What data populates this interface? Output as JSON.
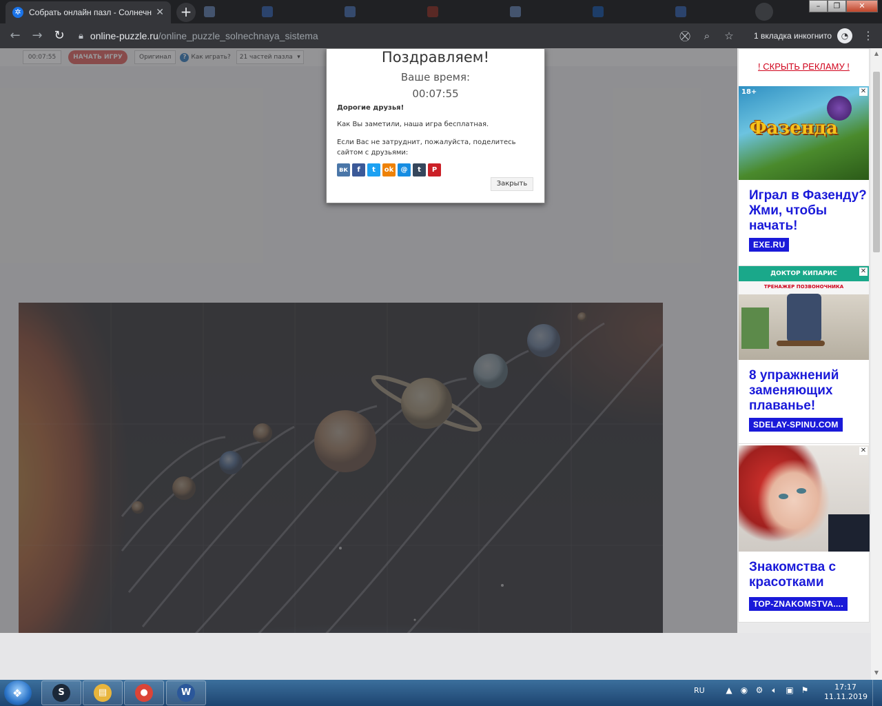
{
  "browser": {
    "active_tab": {
      "title": "Собрать онлайн пазл - Солнечн",
      "favicon": "puzzle-icon"
    },
    "ghost_tabs": [
      {
        "icon": "tab-favicon",
        "color": "#8ab4f8"
      },
      {
        "icon": "tab-favicon",
        "color": "#4285f4"
      },
      {
        "icon": "tab-favicon",
        "color": "#5e97f6"
      },
      {
        "icon": "tab-favicon",
        "color": "#c53929"
      },
      {
        "icon": "tab-favicon",
        "color": "#8ab4f8"
      },
      {
        "icon": "tab-favicon",
        "color": "#1a73e8"
      },
      {
        "icon": "tab-favicon",
        "color": "#4285f4"
      }
    ],
    "new_tab_label": "+",
    "url_host": "online-puzzle.ru",
    "url_path": "/online_puzzle_solnechnaya_sistema",
    "incognito_label": "1 вкладка инкогнито"
  },
  "game_toolbar": {
    "timer": "00:07:55",
    "start_label": "НАЧАТЬ ИГРУ",
    "original_label": "Оригинал",
    "help_label": "Как играть?",
    "pieces_select": "21 частей пазла"
  },
  "modal": {
    "title": "Поздравляем!",
    "time_label": "Ваше время:",
    "time_value": "00:07:55",
    "dear_friends": "Дорогие друзья!",
    "paragraph1": "Как Вы заметили, наша игра бесплатная.",
    "paragraph2": "Если Вас не затруднит, пожалуйста, поделитесь сайтом с друзьями:",
    "share_buttons": [
      {
        "name": "vk",
        "glyph": "вк",
        "color": "#4a76a8"
      },
      {
        "name": "facebook",
        "glyph": "f",
        "color": "#3b5998"
      },
      {
        "name": "twitter",
        "glyph": "t",
        "color": "#1da1f2"
      },
      {
        "name": "odnoklassniki",
        "glyph": "ok",
        "color": "#ee8208"
      },
      {
        "name": "mailru",
        "glyph": "@",
        "color": "#168de2"
      },
      {
        "name": "tumblr",
        "glyph": "t",
        "color": "#35465c"
      },
      {
        "name": "pinterest",
        "glyph": "P",
        "color": "#cb2027"
      }
    ],
    "close_label": "Закрыть"
  },
  "ads": {
    "hide_label": "! СКРЫТЬ РЕКЛАМУ !",
    "items": [
      {
        "age_badge": "18+",
        "image_text": "Фазенда",
        "text": "Играл в Фазенду? Жми, чтобы начать!",
        "domain": "EXE.RU"
      },
      {
        "image_text": "ДОКТОР КИПАРИС",
        "image_subtext": "ТРЕНАЖЕР ПОЗВОНОЧНИКА",
        "text": "8 упражнений заменяющих плаванье!",
        "domain": "SDELAY-SPINU.COM"
      },
      {
        "text": "Знакомства с красотками",
        "domain": "TOP-ZNAKOMSTVA...."
      }
    ]
  },
  "taskbar": {
    "lang": "RU",
    "time": "17:17",
    "date": "11.11.2019",
    "apps": [
      {
        "name": "steam",
        "glyph": "S",
        "color": "#1b2838"
      },
      {
        "name": "file-explorer",
        "glyph": "▤",
        "color": "#e8b53c"
      },
      {
        "name": "chrome",
        "glyph": "●",
        "color": "#db4437"
      },
      {
        "name": "word",
        "glyph": "W",
        "color": "#2b579a"
      }
    ]
  }
}
